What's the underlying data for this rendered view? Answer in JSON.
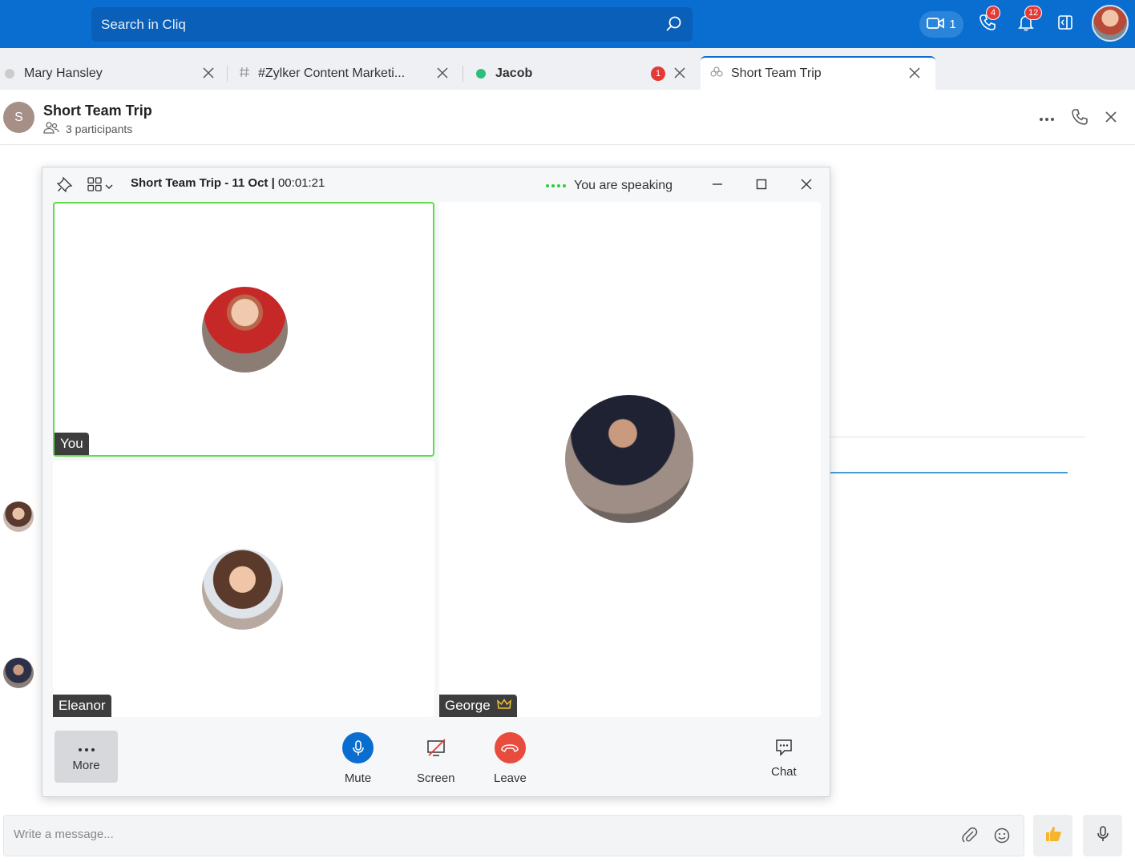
{
  "topbar": {
    "search_placeholder": "Search in Cliq",
    "video_count": "1",
    "calls_badge": "4",
    "notifications_badge": "12"
  },
  "tabs": [
    {
      "label": "Mary Hansley",
      "status_color": "#cccccc"
    },
    {
      "label": "#Zylker Content Marketi...",
      "status_color": ""
    },
    {
      "label": "Jacob",
      "status_color": "#2bbf7a",
      "badge": "1"
    },
    {
      "label": "Short Team Trip",
      "status_color": ""
    }
  ],
  "chat_header": {
    "avatar_initial": "S",
    "title": "Short Team Trip",
    "participants": "3 participants"
  },
  "call": {
    "title": "Short Team Trip - 11 Oct |",
    "timer": "00:01:21",
    "speaking_status": "You are speaking",
    "tiles": [
      {
        "name": "You",
        "speaking": true
      },
      {
        "name": "Eleanor",
        "speaking": false
      },
      {
        "name": "George",
        "speaking": false,
        "host": true
      }
    ],
    "controls": {
      "more": "More",
      "mute": "Mute",
      "screen": "Screen",
      "leave": "Leave",
      "chat": "Chat"
    }
  },
  "composer": {
    "placeholder": "Write a message..."
  },
  "colors": {
    "brand": "#0a6ed1",
    "speaking": "#5fdc4a",
    "leave": "#e74c3c",
    "mute": "#0a6ed1"
  }
}
